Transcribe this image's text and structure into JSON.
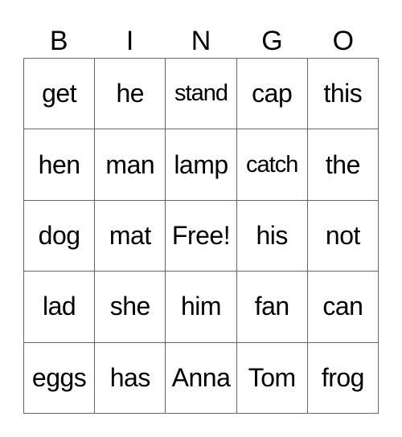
{
  "header": [
    "B",
    "I",
    "N",
    "G",
    "O"
  ],
  "rows": [
    [
      "get",
      "he",
      "stand",
      "cap",
      "this"
    ],
    [
      "hen",
      "man",
      "lamp",
      "catch",
      "the"
    ],
    [
      "dog",
      "mat",
      "Free!",
      "his",
      "not"
    ],
    [
      "lad",
      "she",
      "him",
      "fan",
      "can"
    ],
    [
      "eggs",
      "has",
      "Anna",
      "Tom",
      "frog"
    ]
  ]
}
